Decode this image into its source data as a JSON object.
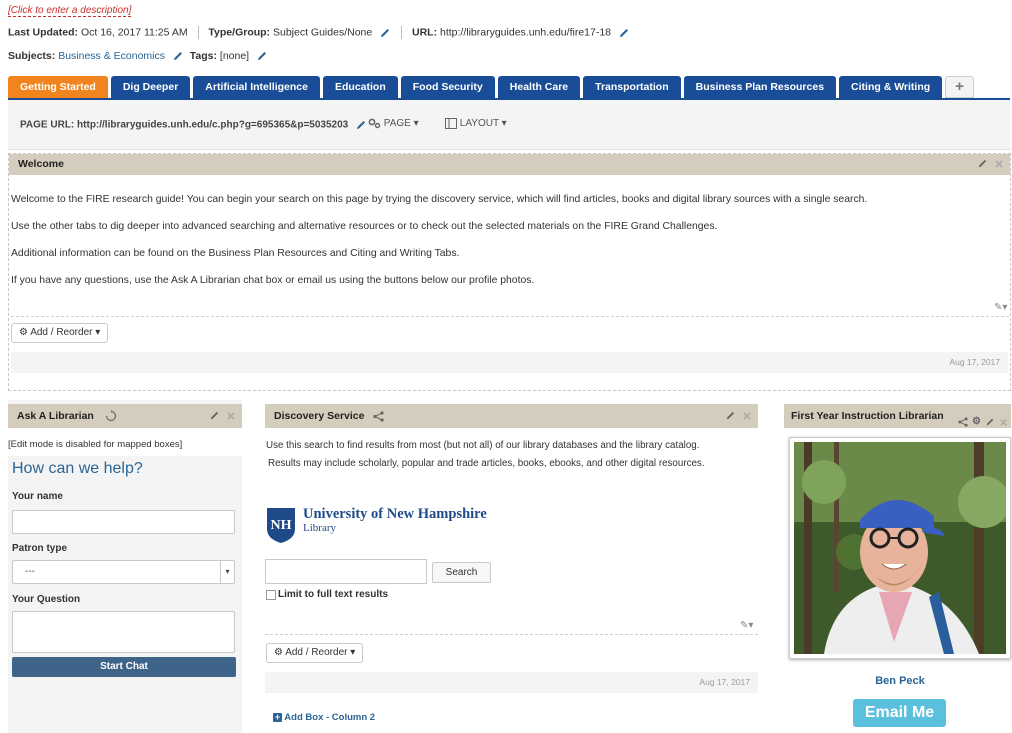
{
  "guide": {
    "description_prompt": "[Click to enter a description]",
    "last_updated_label": "Last Updated:",
    "last_updated_value": "Oct 16, 2017 11:25 AM",
    "type_label": "Type/Group:",
    "type_value": "Subject Guides/None",
    "url_label": "URL:",
    "url_value": "http://libraryguides.unh.edu/fire17-18",
    "subjects_label": "Subjects:",
    "subjects_value": "Business & Economics",
    "tags_label": "Tags:",
    "tags_value": "[none]"
  },
  "tabs": [
    {
      "label": "Getting Started",
      "active": true
    },
    {
      "label": "Dig Deeper"
    },
    {
      "label": "Artificial Intelligence"
    },
    {
      "label": "Education"
    },
    {
      "label": "Food Security"
    },
    {
      "label": "Health Care"
    },
    {
      "label": "Transportation"
    },
    {
      "label": "Business Plan Resources"
    },
    {
      "label": "Citing & Writing"
    }
  ],
  "add_tab_label": "+",
  "page_toolbar": {
    "page_url_label": "PAGE URL:",
    "page_url_value": "http://libraryguides.unh.edu/c.php?g=695365&p=5035203",
    "page_menu": "PAGE",
    "layout_menu": "LAYOUT"
  },
  "welcome": {
    "title": "Welcome",
    "paragraphs": [
      "Welcome to the FIRE research guide!  You can begin your search on this page by trying the discovery service, which will find articles, books and digital library sources with a single search.",
      "Use the other tabs to dig deeper into advanced searching and alternative resources or to check out the selected materials on the FIRE Grand Challenges.",
      "Additional information can be found on the Business Plan Resources and Citing and Writing Tabs.",
      "If you have any questions, use the Ask A Librarian chat box or email us using the buttons below our profile photos."
    ],
    "add_reorder": "Add / Reorder",
    "footer_date": "Aug 17, 2017"
  },
  "ask": {
    "title": "Ask A Librarian",
    "note": "[Edit mode is disabled for mapped boxes]",
    "heading": "How can we help?",
    "name_label": "Your name",
    "patron_label": "Patron type",
    "patron_value": "---",
    "question_label": "Your Question",
    "start_chat": "Start Chat"
  },
  "discovery": {
    "title": "Discovery Service",
    "line1": "Use this search to find results from most (but not all) of our library databases and the library catalog.",
    "line2": "Results may include scholarly, popular and trade articles, books, ebooks, and other digital resources.",
    "logo_name": "University of New Hampshire",
    "logo_sub": "Library",
    "logo_mark": "NH",
    "search_button": "Search",
    "limit_label": "Limit to full text results",
    "add_reorder": "Add / Reorder",
    "footer_date": "Aug 17, 2017",
    "add_box": "Add Box - Column 2"
  },
  "profile": {
    "title": "First Year Instruction Librarian",
    "name": "Ben Peck",
    "email_button": "Email Me"
  },
  "colors": {
    "tab_blue": "#1a4d98",
    "tab_active": "#f0851f",
    "box_header": "#d4cdbd",
    "link": "#2a6496",
    "chat_button": "#3f6489",
    "email_button": "#5bc0de",
    "desc_red": "#c9302c"
  },
  "icons": [
    "pencil-icon",
    "gear-icon",
    "layout-icon",
    "share-icon",
    "close-icon",
    "refresh-icon",
    "plus-icon",
    "edit-dropdown-icon",
    "chevron-down-icon"
  ]
}
